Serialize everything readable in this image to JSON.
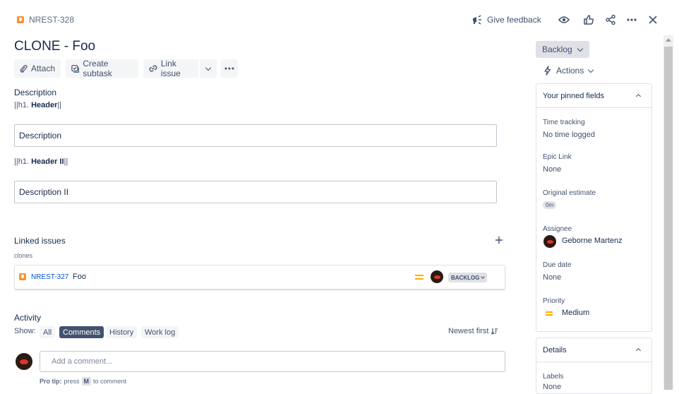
{
  "header": {
    "issue_key": "NREST-328",
    "give_feedback": "Give feedback"
  },
  "issue": {
    "title": "CLONE - Foo"
  },
  "toolbar": {
    "attach": "Attach",
    "create_subtask": "Create subtask",
    "link_issue": "Link issue"
  },
  "description": {
    "label": "Description",
    "h1_prefix": "||h1. ",
    "h1_text": "Header",
    "h1_suffix": "||",
    "box1": "Description",
    "h2_prefix": "||h1. ",
    "h2_text": "Header II",
    "h2_suffix": "||",
    "box2": "Description II"
  },
  "linked": {
    "title": "Linked issues",
    "relation": "clones",
    "item": {
      "key": "NREST-327",
      "summary": "Foo",
      "status": "BACKLOG"
    }
  },
  "activity": {
    "title": "Activity",
    "show_label": "Show:",
    "tabs": [
      "All",
      "Comments",
      "History",
      "Work log"
    ],
    "active_tab": "Comments",
    "sort": "Newest first",
    "comment_placeholder": "Add a comment...",
    "pro_tip_bold": "Pro tip:",
    "pro_tip_press": "press",
    "pro_tip_key": "M",
    "pro_tip_rest": "to comment"
  },
  "side": {
    "status": "Backlog",
    "actions": "Actions",
    "pinned_title": "Your pinned fields",
    "fields": {
      "time_tracking_label": "Time tracking",
      "time_tracking_value": "No time logged",
      "epic_link_label": "Epic Link",
      "epic_link_value": "None",
      "original_estimate_label": "Original estimate",
      "original_estimate_value": "0m",
      "assignee_label": "Assignee",
      "assignee_value": "Geborne Martenz",
      "due_date_label": "Due date",
      "due_date_value": "None",
      "priority_label": "Priority",
      "priority_value": "Medium"
    },
    "details_title": "Details",
    "labels_label": "Labels",
    "labels_value": "None"
  },
  "colors": {
    "accent_blue": "#0052cc",
    "priority_medium": "#ffab00",
    "issue_type": "#f79232"
  }
}
